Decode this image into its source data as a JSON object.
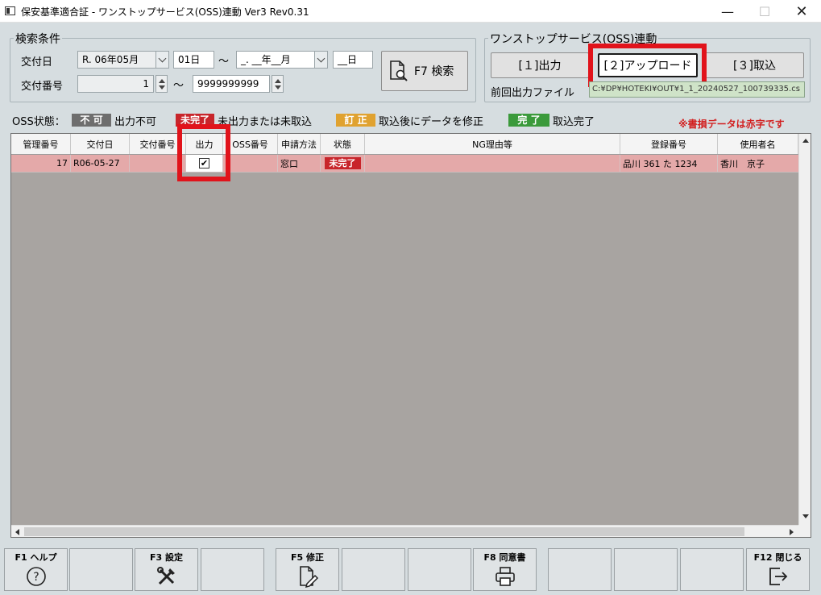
{
  "window": {
    "title": "保安基準適合証 - ワンストップサービス(OSS)連動 Ver3 Rev0.31",
    "min_glyph": "—",
    "max_glyph": "☐",
    "close_glyph": "✕"
  },
  "search": {
    "legend": "検索条件",
    "date_label": "交付日",
    "date_from_ym": "R. 06年05月",
    "date_from_d": "01日",
    "range_sep": "〜",
    "date_to_ym": "_. __年__月",
    "date_to_d": "__日",
    "number_label": "交付番号",
    "number_from": "1",
    "number_to": "9999999999",
    "search_button": "F7 検索"
  },
  "oss": {
    "legend": "ワンストップサービス(OSS)連動",
    "output_button": "[１]出力",
    "upload_button": "[２]アップロード",
    "import_button": "[３]取込",
    "last_file_label": "前回出力ファイル",
    "last_file_value": "C:¥DP¥HOTEKI¥OUT¥1_1_20240527_100739335.cs"
  },
  "status_legend": {
    "label": "OSS状態：",
    "items": [
      {
        "badge": "不 可",
        "text": "出力不可",
        "color": "#6e6e6e"
      },
      {
        "badge": "未完了",
        "text": "未出力または未取込",
        "color": "#c8252b"
      },
      {
        "badge": "訂 正",
        "text": "取込後にデータを修正",
        "color": "#e0a230"
      },
      {
        "badge": "完 了",
        "text": "取込完了",
        "color": "#3b9a3b"
      }
    ],
    "note": "※書損データは赤字です",
    "note_color": "#d21f1f"
  },
  "grid": {
    "columns": [
      "管理番号",
      "交付日",
      "交付番号",
      "出力",
      "OSS番号",
      "申請方法",
      "状態",
      "NG理由等",
      "登録番号",
      "使用者名"
    ],
    "rows": [
      {
        "kanri": "17",
        "date": "R06-05-27",
        "kofu": "",
        "output_checked": true,
        "oss": "",
        "method": "窓口",
        "status": "未完了",
        "ng": "",
        "reg": "品川 361 た 1234",
        "user": "香川　京子"
      }
    ],
    "row_color": "#e4a9a9"
  },
  "fkeys": [
    {
      "label": "F1 ヘルプ",
      "icon": "help-icon"
    },
    {
      "label": "",
      "icon": ""
    },
    {
      "label": "F3 設定",
      "icon": "tools-icon"
    },
    {
      "label": "",
      "icon": ""
    },
    {
      "label": "F5 修正",
      "icon": "edit-document-icon"
    },
    {
      "label": "",
      "icon": ""
    },
    {
      "label": "",
      "icon": ""
    },
    {
      "label": "F8 同意書",
      "icon": "printer-icon"
    },
    {
      "label": "",
      "icon": ""
    },
    {
      "label": "",
      "icon": ""
    },
    {
      "label": "",
      "icon": ""
    },
    {
      "label": "F12 閉じる",
      "icon": "exit-icon"
    }
  ],
  "highlight_color": "#e1131b"
}
